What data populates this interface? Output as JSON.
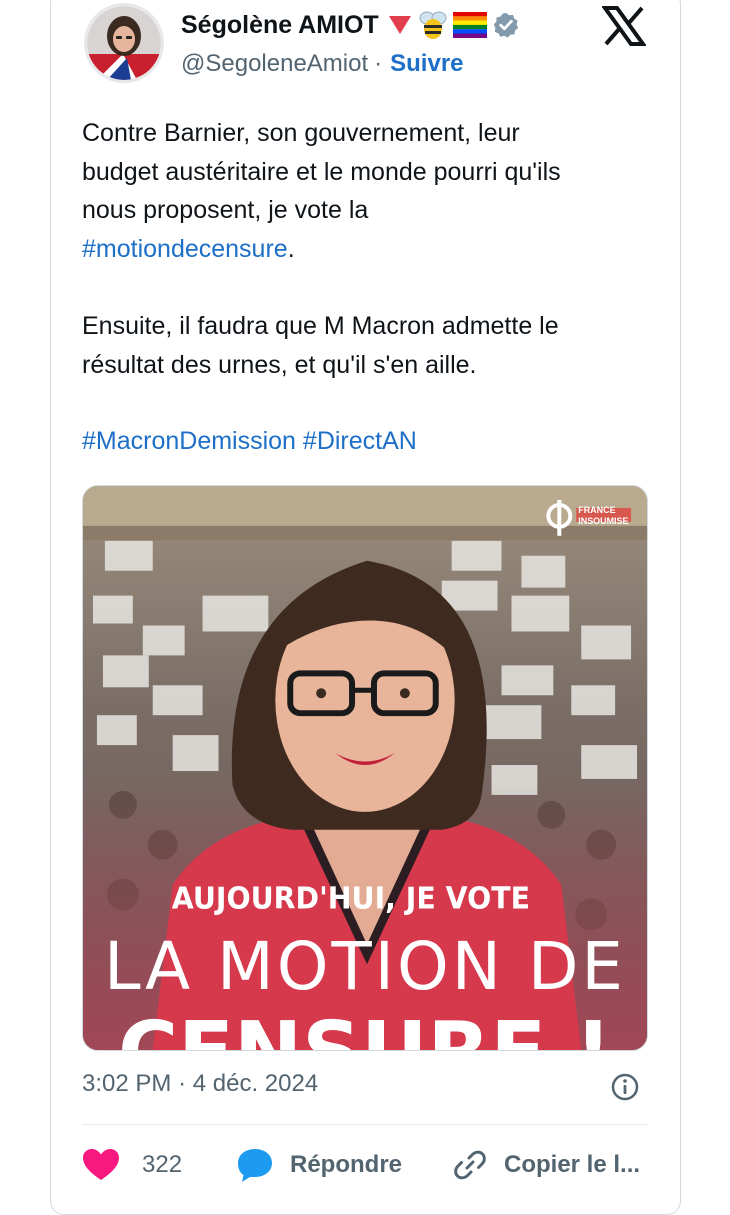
{
  "author": {
    "display_name": "Ségolène AMIOT",
    "handle": "@SegoleneAmiot",
    "separator": "·",
    "follow_label": "Suivre",
    "badges": [
      "triangle-icon",
      "bee-icon",
      "rainbow-flag-icon",
      "verified-badge-icon"
    ]
  },
  "tweet": {
    "line1": "Contre Barnier, son gouvernement, leur",
    "line2": "budget austéritaire et le monde pourri qu'ils",
    "line3": "nous proposent, je vote la",
    "hashtag1": "#motiondecensure",
    "line4_end": ".",
    "p2_line1": "Ensuite, il faudra que M Macron admette le",
    "p2_line2": "résultat des urnes, et qu'il s'en aille.",
    "hashtag2": "#MacronDemission",
    "hashtag3": "#DirectAN"
  },
  "media": {
    "logo_lines": [
      "FRANCE",
      "INSOUMISE"
    ],
    "caption_line1": "AUJOURD'HUI, JE VOTE",
    "caption_line2": "LA MOTION DE",
    "caption_line3": "CENSURE !"
  },
  "meta": {
    "time": "3:02 PM",
    "separator": "·",
    "date": "4 déc. 2024"
  },
  "actions": {
    "like_count": "322",
    "reply_label": "Répondre",
    "copy_label": "Copier le l..."
  },
  "colors": {
    "link": "#1d6fc7",
    "like": "#f91880",
    "reply": "#1d9bf0",
    "text_secondary": "#536471"
  }
}
